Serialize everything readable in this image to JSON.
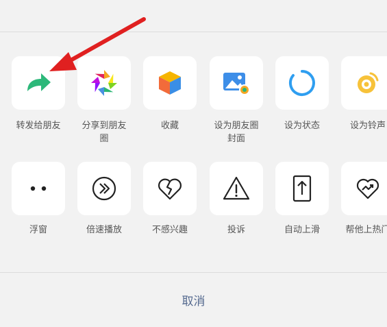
{
  "top_row": {
    "labels": [
      "",
      "",
      "",
      "",
      "",
      ""
    ]
  },
  "share_row": [
    {
      "label": "转发给朋友"
    },
    {
      "label": "分享到朋友\n圈"
    },
    {
      "label": "收藏"
    },
    {
      "label": "设为朋友圈\n封面"
    },
    {
      "label": "设为状态"
    },
    {
      "label": "设为铃声"
    }
  ],
  "action_row": [
    {
      "label": "浮窗"
    },
    {
      "label": "倍速播放"
    },
    {
      "label": "不感兴趣"
    },
    {
      "label": "投诉"
    },
    {
      "label": "自动上滑"
    },
    {
      "label": "帮他上热门"
    }
  ],
  "cancel_label": "取消",
  "colors": {
    "background": "#f2f2f2",
    "tile": "#ffffff",
    "cancel_text": "#556a8f",
    "forward_green": "#2db87a",
    "annotation_red": "#e02020"
  }
}
